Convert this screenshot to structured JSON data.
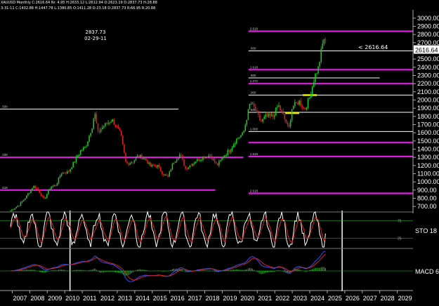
{
  "header": {
    "line1": "XAUUSD Monthly  C:2616.64  Nr.  4.95  H:2633.12  L:2612.94  O:2623.19  D:2837.73  H:28.88",
    "line2": "3-31-11  C:1432.88  H:1447.78  L:1380.85  O:1411.28  D:23.18  D:2837.73  R:66.95  R:20.88"
  },
  "annotation_peak": {
    "value": "2837.73",
    "date": "02-29-11"
  },
  "callout_last": "< 2616.64",
  "colors": {
    "background": "#000000",
    "bull": "#22c822",
    "bear": "#e02020",
    "fib": "#e020e0",
    "white": "#ffffff",
    "yellow": "#f0f000",
    "stoch_k": "#ffffff",
    "stoch_d": "#e02020",
    "macd_line": "#3050ff",
    "macd_signal": "#e02020",
    "macd_hist": "#22c822"
  },
  "chart_data": {
    "type": "candlestick",
    "instrument": "XAUUSD",
    "timeframe": "Monthly",
    "x_ticks": [
      "2007",
      "2008",
      "2009",
      "2010",
      "2011",
      "2012",
      "2013",
      "2014",
      "2015",
      "2016",
      "2017",
      "2018",
      "2019",
      "2020",
      "2021",
      "2022",
      "2023",
      "2024",
      "2025",
      "2026",
      "2027",
      "2028",
      "2029"
    ],
    "y_ticks": [
      700,
      800,
      900,
      1000,
      1100,
      1200,
      1300,
      1400,
      1500,
      1600,
      1700,
      1800,
      1900,
      2000,
      2100,
      2200,
      2300,
      2400,
      2500,
      2600,
      2700,
      2800,
      2900,
      3000
    ],
    "ylim": [
      650,
      3050
    ],
    "xlim": [
      2006.3,
      2029.9
    ],
    "last_price": "2616.64",
    "anchors": [
      [
        2006.9,
        650
      ],
      [
        2007.4,
        720
      ],
      [
        2007.8,
        820
      ],
      [
        2008.2,
        950
      ],
      [
        2008.5,
        900
      ],
      [
        2008.8,
        780
      ],
      [
        2009.2,
        940
      ],
      [
        2009.5,
        960
      ],
      [
        2009.8,
        1110
      ],
      [
        2010.2,
        1120
      ],
      [
        2010.5,
        1230
      ],
      [
        2010.9,
        1380
      ],
      [
        2011.2,
        1430
      ],
      [
        2011.6,
        1700
      ],
      [
        2011.7,
        1860
      ],
      [
        2011.9,
        1600
      ],
      [
        2012.2,
        1680
      ],
      [
        2012.7,
        1760
      ],
      [
        2012.9,
        1690
      ],
      [
        2013.2,
        1580
      ],
      [
        2013.5,
        1220
      ],
      [
        2013.9,
        1250
      ],
      [
        2014.2,
        1320
      ],
      [
        2014.6,
        1280
      ],
      [
        2014.9,
        1190
      ],
      [
        2015.3,
        1200
      ],
      [
        2015.6,
        1100
      ],
      [
        2015.9,
        1060
      ],
      [
        2016.2,
        1240
      ],
      [
        2016.6,
        1340
      ],
      [
        2016.9,
        1160
      ],
      [
        2017.5,
        1260
      ],
      [
        2017.9,
        1300
      ],
      [
        2018.3,
        1330
      ],
      [
        2018.7,
        1200
      ],
      [
        2019.1,
        1320
      ],
      [
        2019.5,
        1410
      ],
      [
        2019.8,
        1520
      ],
      [
        2020.2,
        1590
      ],
      [
        2020.6,
        1970
      ],
      [
        2020.9,
        1880
      ],
      [
        2021.2,
        1730
      ],
      [
        2021.5,
        1800
      ],
      [
        2021.9,
        1800
      ],
      [
        2022.2,
        1940
      ],
      [
        2022.5,
        1800
      ],
      [
        2022.8,
        1640
      ],
      [
        2023.0,
        1920
      ],
      [
        2023.4,
        1980
      ],
      [
        2023.7,
        1880
      ],
      [
        2024.0,
        2040
      ],
      [
        2024.3,
        2300
      ],
      [
        2024.5,
        2400
      ],
      [
        2024.7,
        2650
      ],
      [
        2024.85,
        2780
      ],
      [
        2024.95,
        2617
      ]
    ],
    "fib_lines": [
      {
        "label": "2.618",
        "value": 2840,
        "x_from": 2020.5,
        "x_to": 2029.9,
        "color": "fib"
      },
      {
        "label": ".500",
        "value": 2600,
        "x_from": 2020.5,
        "x_to": 2029.9,
        "color": "white"
      },
      {
        "label": "1.618",
        "value": 2370,
        "x_from": 2020.5,
        "x_to": 2029.9,
        "color": "fib"
      },
      {
        "label": ".500",
        "value": 2270,
        "x_from": 2020.5,
        "x_to": 2028.0,
        "color": "white"
      },
      {
        "label": "1.272",
        "value": 2200,
        "x_from": 2020.5,
        "x_to": 2029.9,
        "color": "fib"
      },
      {
        "label": ".000",
        "value": 2060,
        "x_from": 2020.5,
        "x_to": 2029.9,
        "color": "white"
      },
      {
        "label": ".500",
        "value": 1850,
        "x_from": 2020.5,
        "x_to": 2029.9,
        "color": "white"
      },
      {
        "label": "1.000",
        "value": 1615,
        "x_from": 2020.5,
        "x_to": 2029.9,
        "color": "white"
      },
      {
        "label": "",
        "value": 1480,
        "x_from": 2020.5,
        "x_to": 2029.9,
        "color": "fib"
      },
      {
        "label": "1.618",
        "value": 1310,
        "x_from": 2020.5,
        "x_to": 2029.9,
        "color": "fib"
      },
      {
        "label": "2.618",
        "value": 860,
        "x_from": 2020.5,
        "x_to": 2029.9,
        "color": "fib"
      },
      {
        "label": ".500",
        "value": 1890,
        "x_from": 2006.3,
        "x_to": 2016.5,
        "color": "white"
      },
      {
        "label": ".236",
        "value": 1300,
        "x_from": 2006.3,
        "x_to": 2020.2,
        "color": "fib"
      },
      {
        "label": ".618",
        "value": 900,
        "x_from": 2006.3,
        "x_to": 2018.6,
        "color": "fib"
      }
    ],
    "yellow_marks": [
      [
        2022.6,
        2023.4,
        1840
      ],
      [
        2023.6,
        2024.4,
        2060
      ]
    ],
    "vertical_markers": [
      2010.3,
      2025.85
    ],
    "stochastic": {
      "label": "STO 18",
      "levels": [
        75,
        25
      ]
    },
    "macd": {
      "label": "MACD 6"
    }
  }
}
